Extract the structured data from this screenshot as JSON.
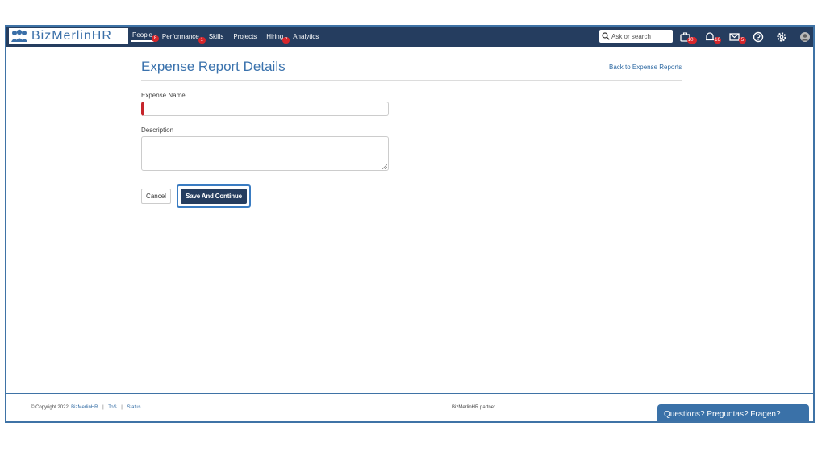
{
  "app": {
    "logo_text": "BizMerlinHR"
  },
  "nav": {
    "items": [
      {
        "label": "People",
        "badge": "8"
      },
      {
        "label": "Performance",
        "badge": "1"
      },
      {
        "label": "Skills",
        "badge": ""
      },
      {
        "label": "Projects",
        "badge": ""
      },
      {
        "label": "Hiring",
        "badge": "7"
      },
      {
        "label": "Analytics",
        "badge": ""
      }
    ]
  },
  "search": {
    "placeholder": "Ask or search"
  },
  "toolbar": {
    "badges": {
      "cases": "10+",
      "notifications": "16",
      "messages": "5"
    }
  },
  "page": {
    "title": "Expense Report Details",
    "back_link": "Back to Expense Reports"
  },
  "form": {
    "expense_name_label": "Expense Name",
    "expense_name_value": "",
    "description_label": "Description",
    "description_value": "",
    "cancel_label": "Cancel",
    "save_label": "Save And Continue"
  },
  "footer": {
    "copyright": "© Copyright 2022,",
    "company_link": "BizMerlinHR",
    "tos": "ToS",
    "status": "Status",
    "separator": "|",
    "partner": "BizMerlinHR.partner"
  },
  "chat": {
    "label": "Questions? Preguntas? Fragen?"
  },
  "colors": {
    "navbar": "#253d5f",
    "accent": "#3a72ad",
    "badge": "#d7262b",
    "required": "#c6252b"
  }
}
